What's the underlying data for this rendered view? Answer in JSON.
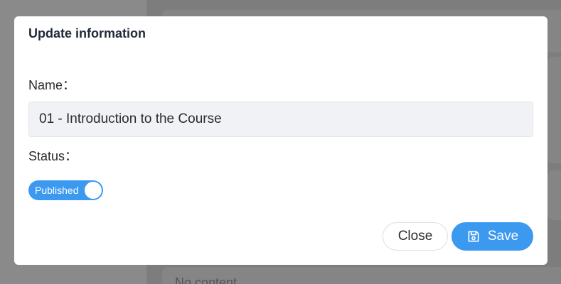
{
  "dialog": {
    "title": "Update information",
    "name_label": "Name：",
    "name_value": "01 - Introduction to the Course",
    "status_label": "Status：",
    "status_toggle_label": "Published",
    "status_toggle_on": true,
    "close_label": "Close",
    "save_label": "Save"
  },
  "background": {
    "partial_text": "No content"
  },
  "colors": {
    "accent": "#3b99f0",
    "overlay": "#7d7d7d",
    "input_bg": "#f1f2f5"
  },
  "icons": {
    "save": "save-icon"
  }
}
